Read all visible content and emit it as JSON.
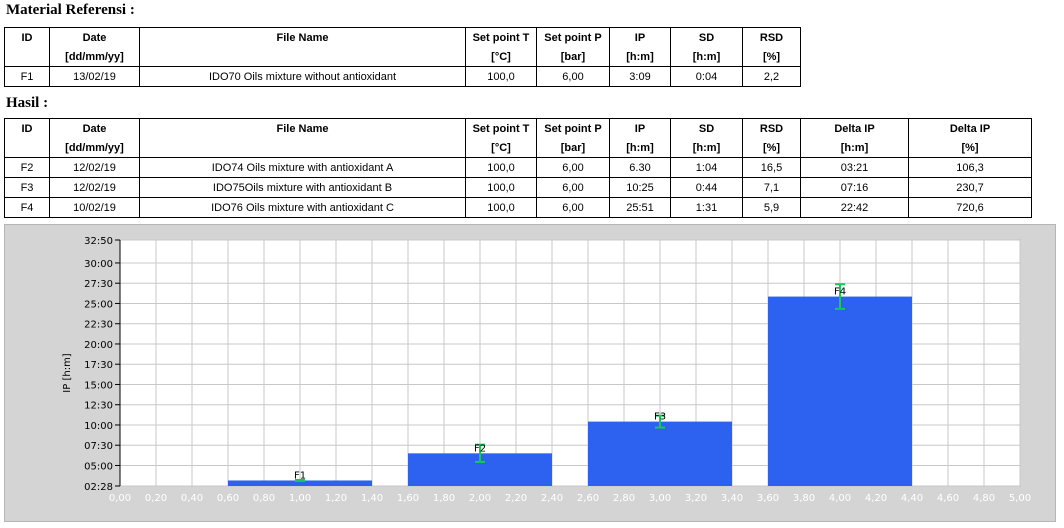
{
  "ref_title": "Material Referensi :",
  "hasil_title": "Hasil :",
  "ref_table": {
    "headers": [
      "ID",
      "Date",
      "File Name",
      "Set point T",
      "Set point P",
      "IP",
      "SD",
      "RSD"
    ],
    "units": [
      "",
      "[dd/mm/yy]",
      "",
      "[°C]",
      "[bar]",
      "[h:m]",
      "[h:m]",
      "[%]"
    ],
    "rows": [
      [
        "F1",
        "13/02/19",
        "IDO70 Oils mixture without antioxidant",
        "100,0",
        "6,00",
        "3:09",
        "0:04",
        "2,2"
      ]
    ]
  },
  "hasil_table": {
    "headers": [
      "ID",
      "Date",
      "File Name",
      "Set point T",
      "Set point P",
      "IP",
      "SD",
      "RSD",
      "Delta IP",
      "Delta IP"
    ],
    "units": [
      "",
      "[dd/mm/yy]",
      "",
      "[°C]",
      "[bar]",
      "[h:m]",
      "[h:m]",
      "[%]",
      "[h:m]",
      "[%]"
    ],
    "rows": [
      [
        "F2",
        "12/02/19",
        "IDO74 Oils mixture with antioxidant A",
        "100,0",
        "6,00",
        "6.30",
        "1:04",
        "16,5",
        "03:21",
        "106,3"
      ],
      [
        "F3",
        "12/02/19",
        "IDO75Oils mixture with antioxidant B",
        "100,0",
        "6,00",
        "10:25",
        "0:44",
        "7,1",
        "07:16",
        "230,7"
      ],
      [
        "F4",
        "10/02/19",
        "IDO76 Oils mixture with antioxidant C",
        "100,0",
        "6,00",
        "25:51",
        "1:31",
        "5,9",
        "22:42",
        "720,6"
      ]
    ]
  },
  "chart_data": {
    "type": "bar",
    "ylabel": "IP [h:m]",
    "x_range": [
      0,
      5
    ],
    "y_range": [
      2.4667,
      32.8333
    ],
    "y_ticks": [
      2.4667,
      5.0,
      7.5,
      10.0,
      12.5,
      15.0,
      17.5,
      20.0,
      22.5,
      25.0,
      27.5,
      30.0,
      32.8333
    ],
    "y_tick_labels": [
      "02:28",
      "05:00",
      "07:30",
      "10:00",
      "12:30",
      "15:00",
      "17:30",
      "20:00",
      "22:30",
      "25:00",
      "27:30",
      "30:00",
      "32:50"
    ],
    "x_ticks": [
      0,
      0.2,
      0.4,
      0.6,
      0.8,
      1.0,
      1.2,
      1.4,
      1.6,
      1.8,
      2.0,
      2.2,
      2.4,
      2.6,
      2.8,
      3.0,
      3.2,
      3.4,
      3.6,
      3.8,
      4.0,
      4.2,
      4.4,
      4.6,
      4.8,
      5.0
    ],
    "x_tick_labels": [
      "0,00",
      "0,20",
      "0,40",
      "0,60",
      "0,80",
      "1,00",
      "1,20",
      "1,40",
      "1,60",
      "1,80",
      "2,00",
      "2,20",
      "2,40",
      "2,60",
      "2,80",
      "3,00",
      "3,20",
      "3,40",
      "3,60",
      "3,80",
      "4,00",
      "4,20",
      "4,40",
      "4,60",
      "4,80",
      "5,00"
    ],
    "grid": true,
    "bar_width": 0.8,
    "bars": [
      {
        "label": "F1",
        "x": 1,
        "value": 3.15,
        "sd": 0.0667
      },
      {
        "label": "F2",
        "x": 2,
        "value": 6.5,
        "sd": 1.0667
      },
      {
        "label": "F3",
        "x": 3,
        "value": 10.4167,
        "sd": 0.7333
      },
      {
        "label": "F4",
        "x": 4,
        "value": 25.85,
        "sd": 1.5167
      }
    ],
    "bar_color": "#2d62f0",
    "error_color": "#18c65a"
  }
}
